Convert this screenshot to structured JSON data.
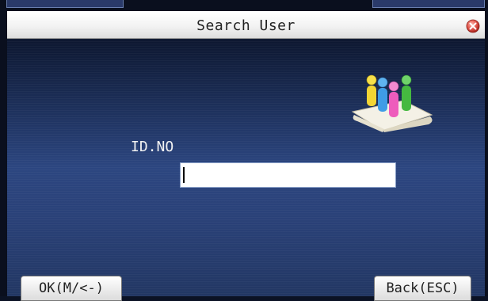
{
  "window": {
    "title": "Search User"
  },
  "form": {
    "id_label": "ID.NO",
    "id_value": ""
  },
  "buttons": {
    "ok_label": "OK(M/<-)",
    "back_label": "Back(ESC)"
  },
  "icons": {
    "close": "close-icon",
    "users": "users-icon"
  },
  "colors": {
    "title_bar": "#f2f2f2",
    "background_top": "#0d1730",
    "background_mid": "#2c4680",
    "close_icon": "#d9534f"
  }
}
